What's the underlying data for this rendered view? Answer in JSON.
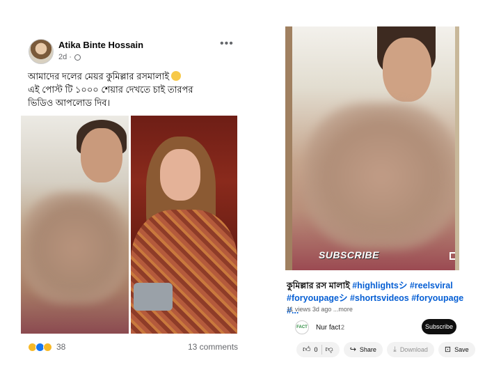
{
  "fb_post": {
    "author": "Atika Binte Hossain",
    "time": "2d ·",
    "text_line1": "আমাদের দলের মেয়র কুমিল্লার রসমালাই",
    "text_line2": "এই পোস্ট টি ১০০০ শেয়ার দেখতে চাই তারপর",
    "text_line3": "ভিডিও আপলোড দিব।",
    "reaction_count": "38",
    "comments": "13 comments"
  },
  "yt_short": {
    "overlay_label": "SUBSCRIBE",
    "title_bengali": "কুমিল্লার রস মালাই",
    "title_tags_1": " #highlightsシ #reelsviral",
    "title_tags_2": "#foryoupageシ #shortsvideos #foryoupage #...",
    "stats": "11 views  3d ago  ...more",
    "channel_logo_text": "FACT",
    "channel_name": "Nur fact",
    "channel_count": "2",
    "subscribe_label": "Subscribe",
    "like_count": "0",
    "share_label": "Share",
    "download_label": "Download",
    "save_label": "Save"
  },
  "colors": {
    "link_blue": "#065fd4",
    "fb_meta_gray": "#65676b",
    "subscribe_black": "#0f0f0f"
  }
}
